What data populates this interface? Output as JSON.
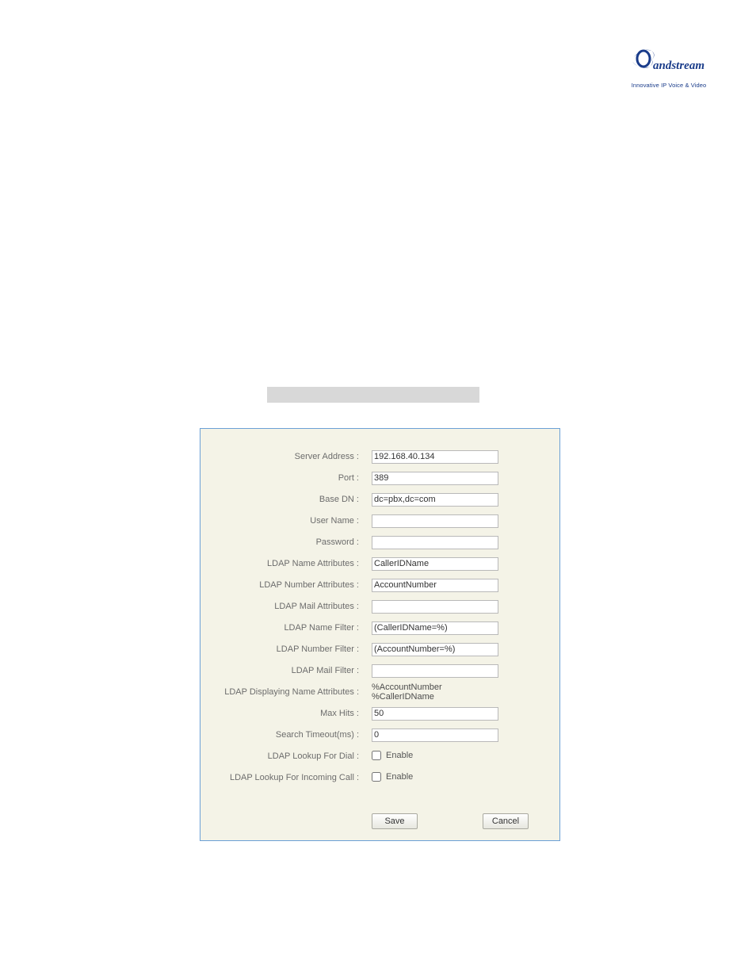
{
  "brand": {
    "name": "Grandstream",
    "tagline": "Innovative IP Voice & Video"
  },
  "caption": "",
  "form": {
    "labels": {
      "server_address": "Server Address :",
      "port": "Port :",
      "base_dn": "Base DN :",
      "user_name": "User Name :",
      "password": "Password :",
      "ldap_name_attributes": "LDAP Name Attributes :",
      "ldap_number_attributes": "LDAP Number Attributes :",
      "ldap_mail_attributes": "LDAP Mail Attributes :",
      "ldap_name_filter": "LDAP Name Filter :",
      "ldap_number_filter": "LDAP Number Filter :",
      "ldap_mail_filter": "LDAP Mail Filter :",
      "ldap_displaying_name_attributes": "LDAP Displaying Name Attributes :",
      "max_hits": "Max Hits :",
      "search_timeout": "Search Timeout(ms) :",
      "ldap_lookup_for_dial": "LDAP Lookup For Dial :",
      "ldap_lookup_for_incoming_call": "LDAP Lookup For Incoming Call :"
    },
    "values": {
      "server_address": "192.168.40.134",
      "port": "389",
      "base_dn": "dc=pbx,dc=com",
      "user_name": "",
      "password": "",
      "ldap_name_attributes": "CallerIDName",
      "ldap_number_attributes": "AccountNumber",
      "ldap_mail_attributes": "",
      "ldap_name_filter": "(CallerIDName=%)",
      "ldap_number_filter": "(AccountNumber=%)",
      "ldap_mail_filter": "",
      "ldap_displaying_name_attributes": "%AccountNumber %CallerIDName",
      "max_hits": "50",
      "search_timeout": "0"
    },
    "check_label": "Enable",
    "buttons": {
      "save": "Save",
      "cancel": "Cancel"
    }
  }
}
